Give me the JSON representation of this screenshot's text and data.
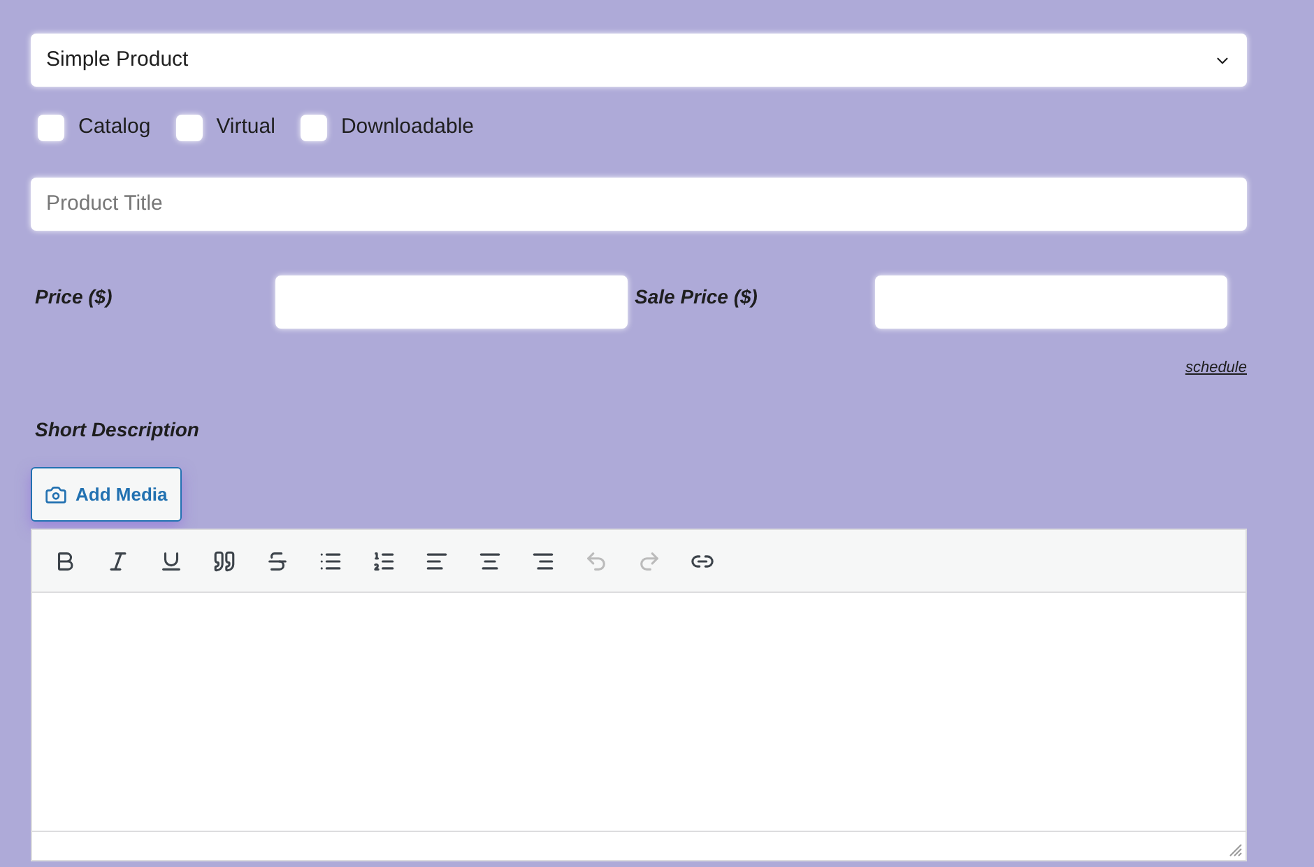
{
  "product_type": {
    "value": "Simple Product"
  },
  "options": [
    {
      "label": "Catalog",
      "checked": false
    },
    {
      "label": "Virtual",
      "checked": false
    },
    {
      "label": "Downloadable",
      "checked": false
    }
  ],
  "title_field": {
    "placeholder": "Product Title"
  },
  "prices": [
    {
      "label": "Price ($)"
    },
    {
      "label": "Sale Price ($)"
    }
  ],
  "schedule_link": "schedule",
  "short_description": {
    "label": "Short Description",
    "add_media": "Add Media",
    "toolbar": [
      {
        "kind": "bold",
        "disabled": false
      },
      {
        "kind": "italic",
        "disabled": false
      },
      {
        "kind": "underline",
        "disabled": false
      },
      {
        "kind": "quote",
        "disabled": false
      },
      {
        "kind": "strikethrough",
        "disabled": false
      },
      {
        "kind": "bullets",
        "disabled": false
      },
      {
        "kind": "numbers",
        "disabled": false
      },
      {
        "kind": "align-left",
        "disabled": false
      },
      {
        "kind": "align-center",
        "disabled": false
      },
      {
        "kind": "align-right",
        "disabled": false
      },
      {
        "kind": "undo",
        "disabled": true
      },
      {
        "kind": "redo",
        "disabled": true
      },
      {
        "kind": "link",
        "disabled": false
      }
    ]
  }
}
